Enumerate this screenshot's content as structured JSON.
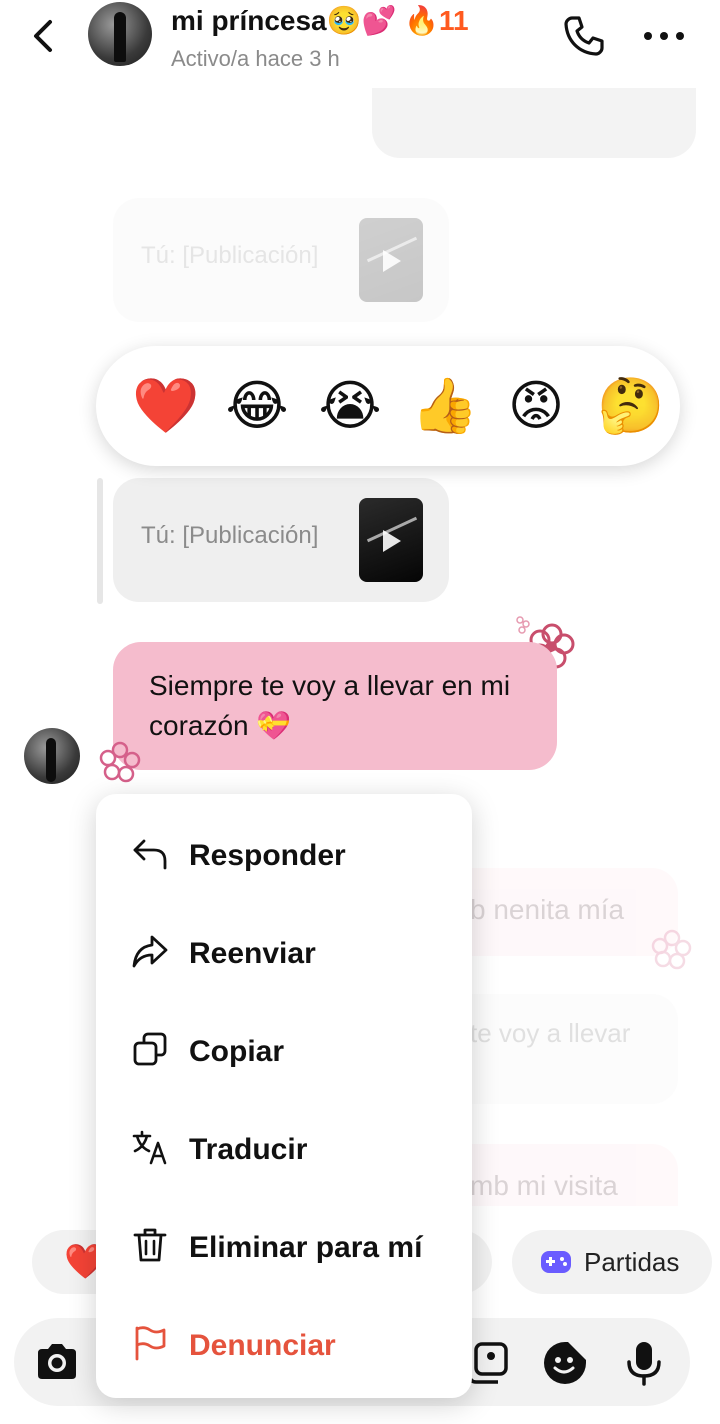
{
  "header": {
    "name": "mi príncesa🥹💕",
    "streak_icon": "🔥",
    "streak_count": "11",
    "status": "Activo/a hace 3 h"
  },
  "chat": {
    "post_label_1": "Tú: [Publicación]",
    "post_label_2": "Tú: [Publicación]",
    "message_text": "Siempre te voy a llevar en mi corazón 💝",
    "faded_1": "b nenita mía",
    "faded_2": "te voy a llevar",
    "faded_3": "mb mi visita"
  },
  "reactions": [
    "❤️",
    "😂",
    "😭",
    "👍",
    "😡",
    "🤔"
  ],
  "chips": {
    "left_emoji": "❤️",
    "partidas_label": "Partidas"
  },
  "menu": {
    "items": [
      {
        "label": "Responder",
        "icon": "reply-icon"
      },
      {
        "label": "Reenviar",
        "icon": "forward-icon"
      },
      {
        "label": "Copiar",
        "icon": "copy-icon"
      },
      {
        "label": "Traducir",
        "icon": "translate-icon"
      },
      {
        "label": "Eliminar para mí",
        "icon": "trash-icon"
      },
      {
        "label": "Denunciar",
        "icon": "flag-icon"
      }
    ],
    "danger_color": "#e5533d"
  },
  "colors": {
    "bubble_pink": "#f5bccd",
    "streak_orange": "#ff5a1f",
    "games_purple": "#6a5cff"
  }
}
